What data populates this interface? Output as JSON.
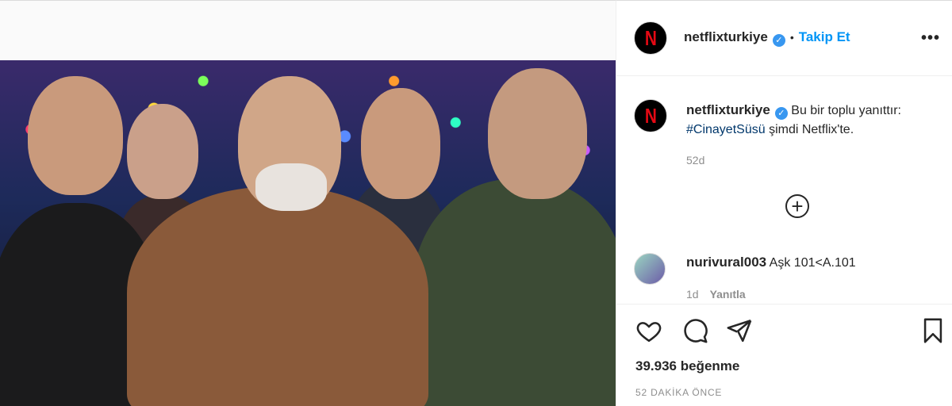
{
  "post": {
    "account": {
      "username": "netflixturkiye",
      "avatar_letter": "N",
      "verified_icon": "verified-icon",
      "dot": "•",
      "follow_label": "Takip Et",
      "more_label": "•••"
    },
    "caption": {
      "username": "netflixturkiye",
      "text_before": "Bu bir toplu yanıttır: ",
      "hashtag": "#CinayetSüsü",
      "text_after": " şimdi Netflix'te.",
      "time": "52d"
    },
    "load_more_label": "+",
    "comment": {
      "username": "nurivural003",
      "text": "Aşk 101<A.101",
      "time": "1d",
      "reply_label": "Yanıtla"
    },
    "likes_text": "39.936 beğenme",
    "posted_text": "52 DAKİKA ÖNCE"
  },
  "colors": {
    "link": "#0095f6",
    "hashtag": "#00376b",
    "muted": "#8e8e8e",
    "netflix_red": "#e50914"
  }
}
